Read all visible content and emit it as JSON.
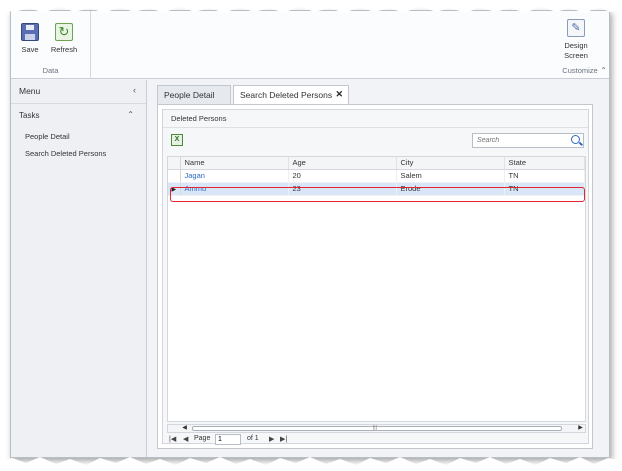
{
  "ribbon": {
    "save_label": "Save",
    "refresh_label": "Refresh",
    "data_group_label": "Data",
    "design_label_line1": "Design",
    "design_label_line2": "Screen",
    "customize_group_label": "Customize"
  },
  "nav": {
    "menu_label": "Menu",
    "tasks_label": "Tasks",
    "items": [
      {
        "label": "People Detail"
      },
      {
        "label": "Search Deleted Persons"
      }
    ]
  },
  "tabs": [
    {
      "label": "People Detail",
      "active": false
    },
    {
      "label": "Search Deleted Persons",
      "active": true
    }
  ],
  "grid": {
    "title": "Deleted Persons",
    "search_placeholder": "Search",
    "columns": [
      "Name",
      "Age",
      "City",
      "State"
    ],
    "rows": [
      {
        "name": "Jagan",
        "age": "20",
        "city": "Salem",
        "state": "TN",
        "selected": false
      },
      {
        "name": "Ammu",
        "age": "23",
        "city": "Erode",
        "state": "TN",
        "selected": true
      }
    ],
    "selection_color": "#e0262f"
  },
  "pager": {
    "page_label": "Page",
    "page_value": "1",
    "of_label": "of 1"
  },
  "icons": [
    "save-icon",
    "refresh-icon",
    "design-screen-icon",
    "excel-export-icon",
    "search-icon",
    "close-icon"
  ]
}
